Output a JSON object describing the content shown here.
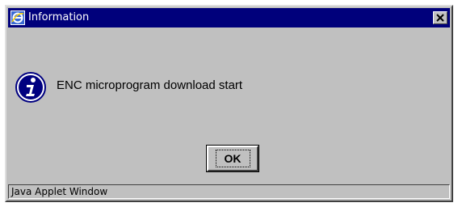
{
  "window": {
    "title": "Information",
    "close_glyph": "✕",
    "titlebar_color": "#00007b",
    "face_color": "#c0c0c0"
  },
  "icons": {
    "app": "browser-app-icon",
    "close": "close-icon",
    "message": "information-icon"
  },
  "message": {
    "text": "ENC microprogram download start"
  },
  "buttons": {
    "ok_label": "OK"
  },
  "status": {
    "text": "Java Applet Window"
  }
}
